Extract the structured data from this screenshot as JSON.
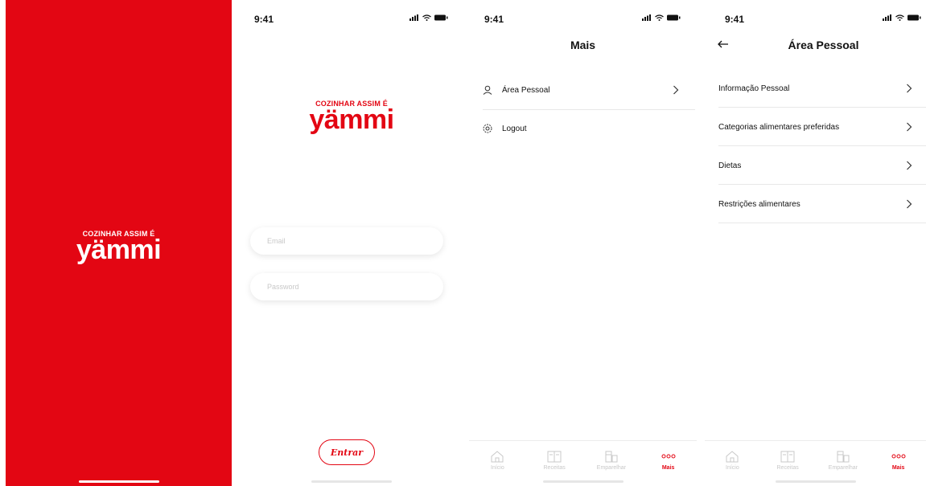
{
  "brand": {
    "tagline": "COZINHAR ASSIM É",
    "wordmark": "yämmi",
    "color": "#e30613"
  },
  "status": {
    "time": "9:41"
  },
  "login": {
    "email_placeholder": "Email",
    "password_placeholder": "Password",
    "enter_label": "Entrar"
  },
  "more": {
    "title": "Mais",
    "items": [
      {
        "label": "Área Pessoal",
        "icon": "user-icon"
      },
      {
        "label": "Logout",
        "icon": "settings-icon"
      }
    ]
  },
  "personal": {
    "title": "Área Pessoal",
    "items": [
      {
        "label": "Informação Pessoal"
      },
      {
        "label": "Categorias alimentares preferidas"
      },
      {
        "label": "Dietas"
      },
      {
        "label": "Restrições alimentares"
      }
    ]
  },
  "tabs": [
    {
      "label": "Início",
      "icon": "home-icon"
    },
    {
      "label": "Receitas",
      "icon": "book-icon"
    },
    {
      "label": "Emparelhar",
      "icon": "pairing-icon"
    },
    {
      "label": "Mais",
      "icon": "more-icon",
      "active": true
    }
  ]
}
